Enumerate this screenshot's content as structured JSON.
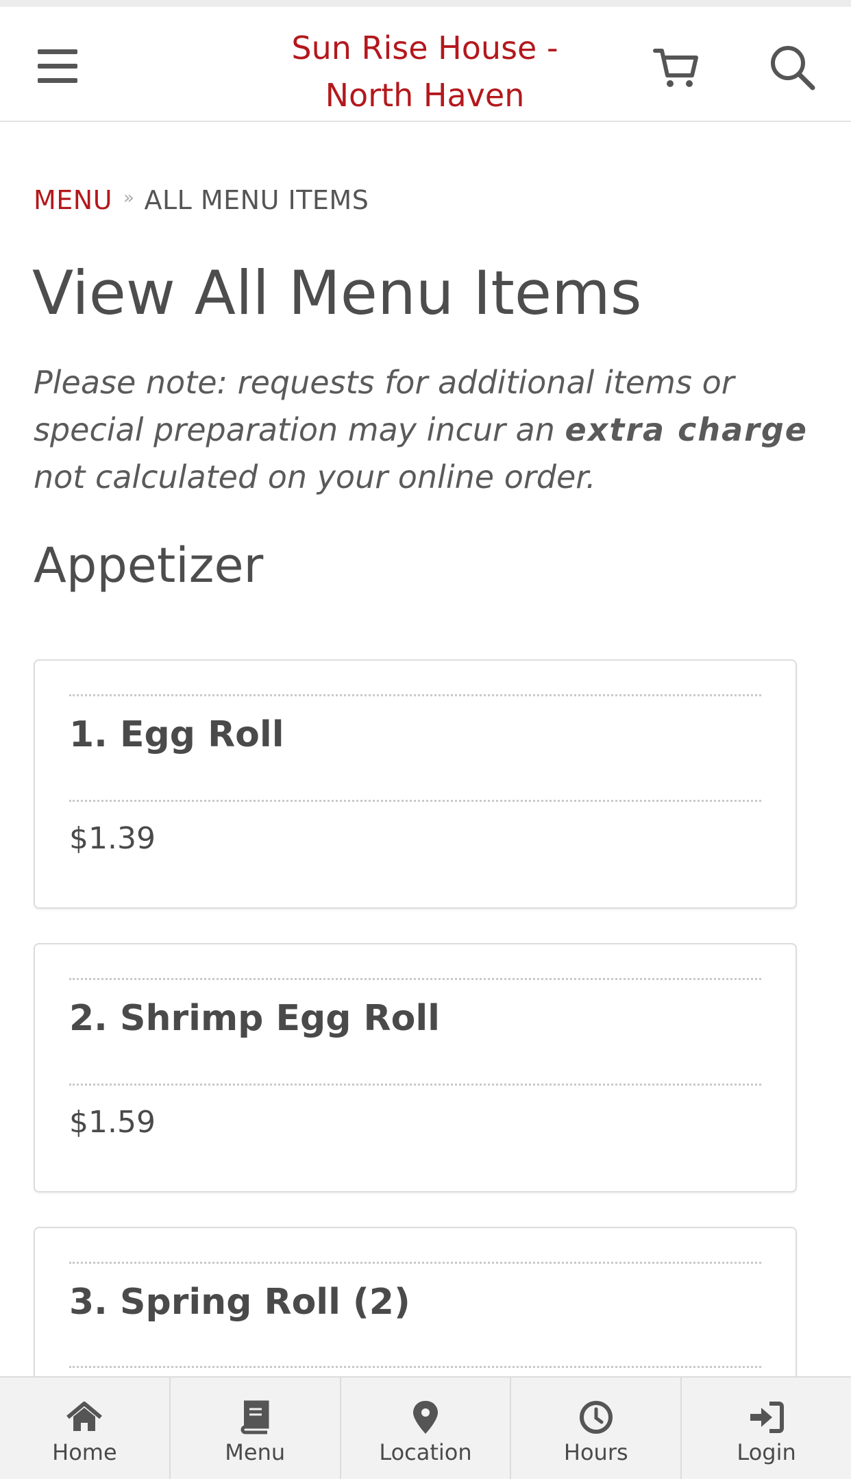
{
  "header": {
    "title_line1": "Sun Rise House -",
    "title_line2": "North Haven",
    "brand_color": "#b3181c",
    "icons": [
      "menu-icon",
      "cart-icon",
      "search-icon"
    ]
  },
  "breadcrumb": {
    "menu": "MENU",
    "separator": "»",
    "current": "ALL MENU ITEMS"
  },
  "page": {
    "title": "View All Menu Items",
    "note_before": "Please note: requests for additional items or special preparation may incur an ",
    "note_bold": "extra charge",
    "note_after": " not calculated on your online order."
  },
  "section": {
    "title": "Appetizer"
  },
  "items": [
    {
      "name": "1. Egg Roll",
      "price": "$1.39"
    },
    {
      "name": "2. Shrimp Egg Roll",
      "price": "$1.59"
    },
    {
      "name": "3. Spring Roll (2)",
      "price": ""
    }
  ],
  "bottom_nav": [
    {
      "label": "Home",
      "icon": "home-icon"
    },
    {
      "label": "Menu",
      "icon": "book-icon"
    },
    {
      "label": "Location",
      "icon": "map-pin-icon"
    },
    {
      "label": "Hours",
      "icon": "clock-icon"
    },
    {
      "label": "Login",
      "icon": "login-icon"
    }
  ]
}
